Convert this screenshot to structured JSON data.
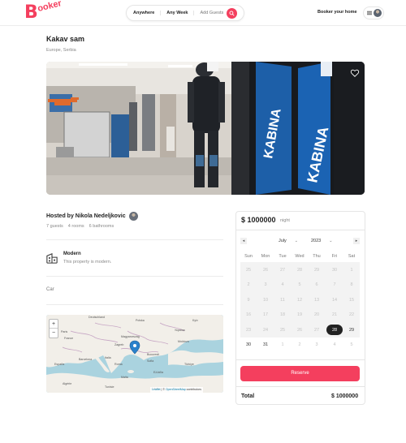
{
  "brand": {
    "logo_initial": "B",
    "logo_rest": "ooker",
    "accent": "#f43f5e"
  },
  "header": {
    "search": {
      "where": "Anywhere",
      "when": "Any Week",
      "guests": "Add Guests"
    },
    "host_link": "Booker your home"
  },
  "listing": {
    "title": "Kakav sam",
    "location": "Europe, Serbia",
    "host_label": "Hosted by Nikola Nedeljkovic",
    "guests": "7 guests",
    "rooms": "4 rooms",
    "bathrooms": "6 bathrooms",
    "category": {
      "name": "Modern",
      "description": "This property is modern."
    },
    "description": "Car",
    "image_signs": [
      "KABINA",
      "KABINA"
    ]
  },
  "map": {
    "zoom_in": "+",
    "zoom_out": "−",
    "labels": [
      "Deutschland",
      "Polska",
      "France",
      "Italia",
      "España",
      "Україна",
      "Magyarország",
      "Ελλάδα",
      "Türkiye",
      "Algérie",
      "Tunisie",
      "Zagreb",
      "Bucuresti",
      "Sofia",
      "Roma",
      "Barcelona",
      "Kyiv",
      "Paris",
      "Moldova",
      "Malta",
      "Libya"
    ],
    "attribution_leaflet": "Leaflet",
    "attribution_sep": "| ©",
    "attribution_osm": "OpenStreetMap",
    "attribution_rest": "contributors"
  },
  "booking": {
    "price": "$ 1000000",
    "per": "night",
    "calendar": {
      "prev": "◂",
      "next": "▸",
      "month": "July",
      "year": "2023",
      "weekdays": [
        "Sun",
        "Mon",
        "Tue",
        "Wed",
        "Thu",
        "Fri",
        "Sat"
      ],
      "weeks": [
        [
          {
            "d": "25",
            "a": false
          },
          {
            "d": "26",
            "a": false
          },
          {
            "d": "27",
            "a": false
          },
          {
            "d": "28",
            "a": false
          },
          {
            "d": "29",
            "a": false
          },
          {
            "d": "30",
            "a": false
          },
          {
            "d": "1",
            "a": false
          }
        ],
        [
          {
            "d": "2",
            "a": false
          },
          {
            "d": "3",
            "a": false
          },
          {
            "d": "4",
            "a": false
          },
          {
            "d": "5",
            "a": false
          },
          {
            "d": "6",
            "a": false
          },
          {
            "d": "7",
            "a": false
          },
          {
            "d": "8",
            "a": false
          }
        ],
        [
          {
            "d": "9",
            "a": false
          },
          {
            "d": "10",
            "a": false
          },
          {
            "d": "11",
            "a": false
          },
          {
            "d": "12",
            "a": false
          },
          {
            "d": "13",
            "a": false
          },
          {
            "d": "14",
            "a": false
          },
          {
            "d": "15",
            "a": false
          }
        ],
        [
          {
            "d": "16",
            "a": false
          },
          {
            "d": "17",
            "a": false
          },
          {
            "d": "18",
            "a": false
          },
          {
            "d": "19",
            "a": false
          },
          {
            "d": "20",
            "a": false
          },
          {
            "d": "21",
            "a": false
          },
          {
            "d": "22",
            "a": false
          }
        ],
        [
          {
            "d": "23",
            "a": false
          },
          {
            "d": "24",
            "a": false
          },
          {
            "d": "25",
            "a": false
          },
          {
            "d": "26",
            "a": false
          },
          {
            "d": "27",
            "a": false
          },
          {
            "d": "28",
            "a": true,
            "s": true
          },
          {
            "d": "29",
            "a": true
          }
        ],
        [
          {
            "d": "30",
            "a": true
          },
          {
            "d": "31",
            "a": true
          },
          {
            "d": "1",
            "a": false
          },
          {
            "d": "2",
            "a": false
          },
          {
            "d": "3",
            "a": false
          },
          {
            "d": "4",
            "a": false
          },
          {
            "d": "5",
            "a": false
          }
        ]
      ]
    },
    "reserve_label": "Reserve",
    "total_label": "Total",
    "total_value": "$ 1000000"
  }
}
